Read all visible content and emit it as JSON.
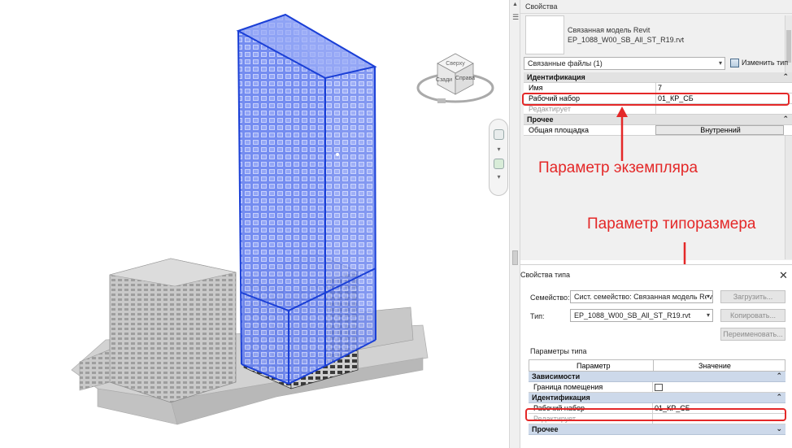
{
  "properties": {
    "title": "Свойства",
    "type_name_line1": "Связанная модель Revit",
    "type_name_line2": "EP_1088_W00_SB_All_ST_R19.rvt",
    "filter": "Связанные файлы (1)",
    "edit_type": "Изменить тип",
    "sections": [
      {
        "label": "Идентификация",
        "rows": [
          {
            "key": "Имя",
            "value": "7"
          },
          {
            "key": "Рабочий набор",
            "value": "01_КР_СБ"
          },
          {
            "key": "Редактирует",
            "value": ""
          }
        ]
      },
      {
        "label": "Прочее",
        "rows": [
          {
            "key": "Общая площадка",
            "value": "Внутренний"
          }
        ]
      }
    ]
  },
  "annotations": {
    "instance_param": "Параметр экземпляра",
    "type_param": "Параметр типоразмера",
    "color": "#e42828"
  },
  "type_properties": {
    "title": "Свойства типа",
    "family_label": "Семейство:",
    "family_value": "Сист. семейство: Связанная модель Revit",
    "type_label": "Тип:",
    "type_value": "EP_1088_W00_SB_All_ST_R19.rvt",
    "load_btn": "Загрузить...",
    "copy_btn": "Копировать...",
    "rename_btn": "Переименовать...",
    "params_label": "Параметры типа",
    "col_param": "Параметр",
    "col_value": "Значение",
    "sections": [
      {
        "label": "Зависимости",
        "rows": [
          {
            "key": "Граница помещения",
            "value": ""
          }
        ]
      },
      {
        "label": "Идентификация",
        "rows": [
          {
            "key": "Рабочий набор",
            "value": "01_КР_СБ"
          },
          {
            "key": "Редактирует",
            "value": ""
          }
        ]
      },
      {
        "label": "Прочее",
        "rows": []
      }
    ]
  },
  "viewcube": {
    "face_top": "Сверху",
    "face_left": "Сзади",
    "face_right": "Справа"
  },
  "colors": {
    "selection": "#1a3fd6",
    "building": "#bdbdbd",
    "panel": "#f0f0f0",
    "section": "#cdd9ea"
  }
}
